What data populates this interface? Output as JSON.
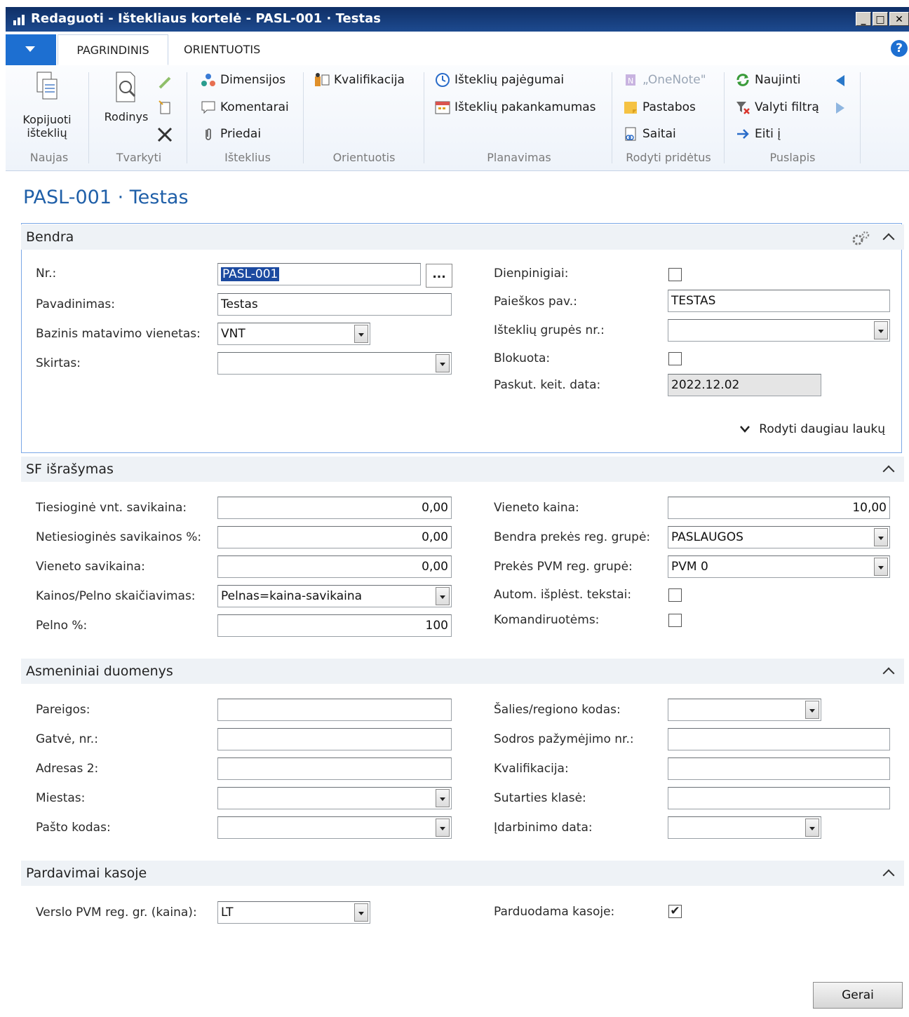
{
  "window": {
    "title": "Redaguoti - Ištekliaus kortelė - PASL-001 · Testas"
  },
  "tabs": [
    {
      "label": "PAGRINDINIS"
    },
    {
      "label": "ORIENTUOTIS"
    }
  ],
  "ribbon": {
    "groups": [
      {
        "label": "Naujas"
      },
      {
        "label": "Tvarkyti"
      },
      {
        "label": "Išteklius"
      },
      {
        "label": "Orientuotis"
      },
      {
        "label": "Planavimas"
      },
      {
        "label": "Rodyti pridėtus"
      },
      {
        "label": "Puslapis"
      }
    ],
    "copy_line1": "Kopijuoti",
    "copy_line2": "išteklių",
    "view_label": "Rodinys",
    "dimensions": "Dimensijos",
    "comments": "Komentarai",
    "attachments": "Priedai",
    "qualification": "Kvalifikacija",
    "capacity": "Išteklių pajėgumai",
    "availability": "Išteklių pakankamumas",
    "onenote": "„OneNote\"",
    "notes": "Pastabos",
    "links": "Saitai",
    "refresh": "Naujinti",
    "clear_filter": "Valyti filtrą",
    "goto": "Eiti į"
  },
  "page": {
    "title": "PASL-001 · Testas"
  },
  "general": {
    "title": "Bendra",
    "no_label": "Nr.:",
    "no_value": "PASL-001",
    "name_label": "Pavadinimas:",
    "name_value": "Testas",
    "uom_label": "Bazinis matavimo vienetas:",
    "uom_value": "VNT",
    "assigned_label": "Skirtas:",
    "assigned_value": "",
    "privacy_label": "Dienpinigiai:",
    "search_label": "Paieškos pav.:",
    "search_value": "TESTAS",
    "group_label": "Išteklių grupės nr.:",
    "group_value": "",
    "blocked_label": "Blokuota:",
    "lastmod_label": "Paskut. keit. data:",
    "lastmod_value": "2022.12.02",
    "more_fields": "Rodyti daugiau laukų"
  },
  "invoicing": {
    "title": "SF išrašymas",
    "direct_cost_label": "Tiesioginė vnt. savikaina:",
    "direct_cost_value": "0,00",
    "indirect_label": "Netiesioginės savikainos %:",
    "indirect_value": "0,00",
    "unit_cost_label": "Vieneto savikaina:",
    "unit_cost_value": "0,00",
    "price_calc_label": "Kainos/Pelno skaičiavimas:",
    "price_calc_value": "Pelnas=kaina-savikaina",
    "profit_label": "Pelno %:",
    "profit_value": "100",
    "unit_price_label": "Vieneto kaina:",
    "unit_price_value": "10,00",
    "gen_prod_label": "Bendra prekės reg. grupė:",
    "gen_prod_value": "PASLAUGOS",
    "vat_prod_label": "Prekės PVM reg. grupė:",
    "vat_prod_value": "PVM 0",
    "auto_ext_label": "Autom. išplėst. tekstai:",
    "travel_label": "Komandiruotėms:"
  },
  "personal": {
    "title": "Asmeniniai duomenys",
    "job_label": "Pareigos:",
    "job_value": "",
    "street_label": "Gatvė, nr.:",
    "street_value": "",
    "address2_label": "Adresas 2:",
    "address2_value": "",
    "city_label": "Miestas:",
    "city_value": "",
    "post_label": "Pašto kodas:",
    "post_value": "",
    "country_label": "Šalies/regiono kodas:",
    "country_value": "",
    "ss_label": "Sodros pažymėjimo nr.:",
    "ss_value": "",
    "edu_label": "Kvalifikacija:",
    "edu_value": "",
    "contract_label": "Sutarties klasė:",
    "contract_value": "",
    "employ_label": "Įdarbinimo data:",
    "employ_value": ""
  },
  "pos": {
    "title": "Pardavimai kasoje",
    "vat_bus_label": "Verslo PVM reg. gr. (kaina):",
    "vat_bus_value": "LT",
    "sold_label": "Parduodama kasoje:",
    "sold_checked": "✔"
  },
  "buttons": {
    "ok": "Gerai"
  },
  "colors": {
    "accent": "#1d6fd1",
    "title_blue": "#1f5fa8",
    "titlebar": "#163b78"
  }
}
